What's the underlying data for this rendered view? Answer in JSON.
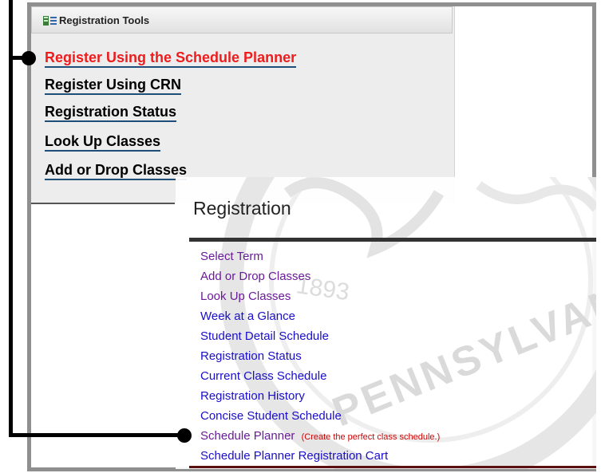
{
  "tools_panel": {
    "title": "Registration Tools",
    "links": [
      {
        "label": "Register Using the Schedule Planner",
        "active": true
      },
      {
        "label": "Register Using CRN"
      },
      {
        "label": "Registration Status"
      },
      {
        "label": "Look Up Classes"
      },
      {
        "label": "Add or Drop Classes"
      }
    ]
  },
  "registration_menu": {
    "title": "Registration",
    "items": [
      {
        "label": "Select Term",
        "visited": true
      },
      {
        "label": "Add or Drop Classes",
        "visited": true
      },
      {
        "label": "Look Up Classes",
        "visited": true
      },
      {
        "label": "Week at a Glance"
      },
      {
        "label": "Student Detail Schedule"
      },
      {
        "label": "Registration Status"
      },
      {
        "label": "Current Class Schedule"
      },
      {
        "label": "Registration History"
      },
      {
        "label": "Concise Student Schedule"
      },
      {
        "label": "Schedule Planner",
        "note": "(Create the perfect class schedule.)"
      },
      {
        "label": "Schedule Planner Registration Cart"
      }
    ]
  },
  "watermark": {
    "year": "1893",
    "text": "PENNSYLVANIA"
  },
  "colors": {
    "active_link": "#ee1c1c",
    "link": "#1a0dcc",
    "visited_link": "#6a1b9a",
    "note": "#cc0000"
  }
}
